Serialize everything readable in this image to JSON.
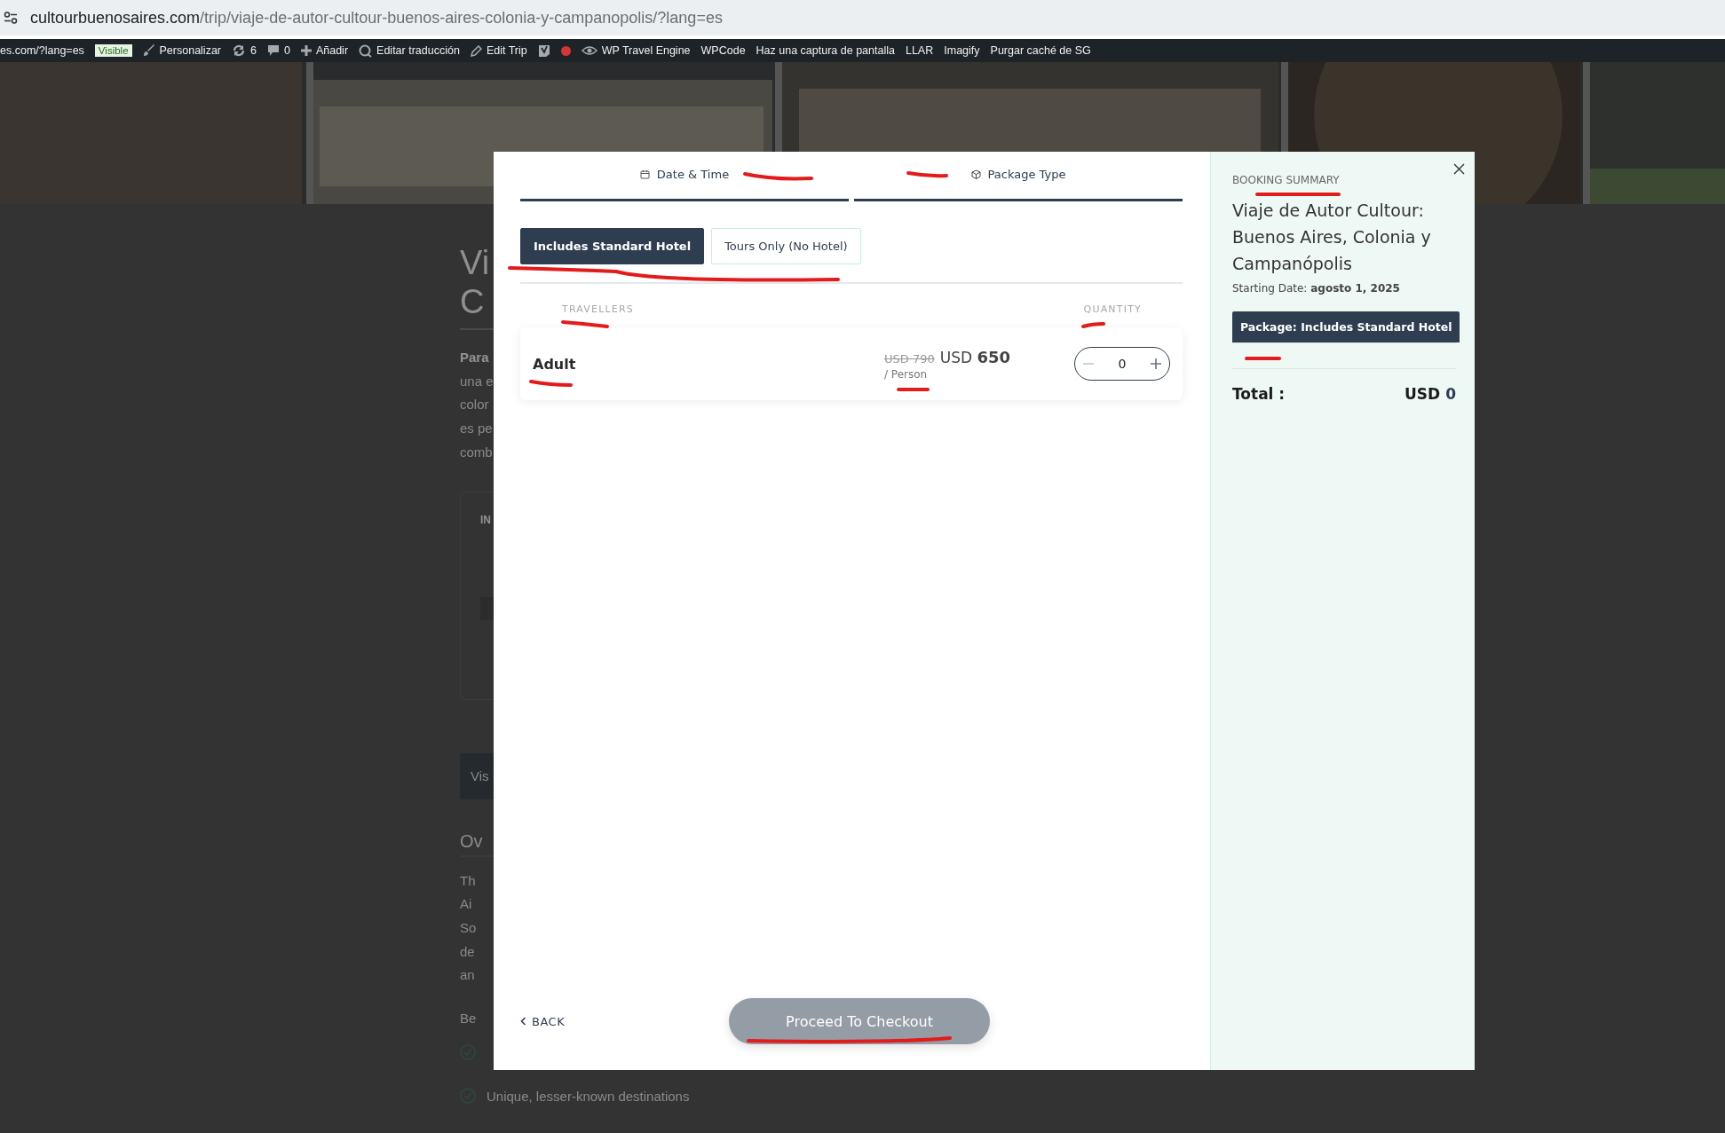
{
  "browser": {
    "url_host": "cultourbuenosaires.com",
    "url_path": "/trip/viaje-de-autor-cultour-buenos-aires-colonia-y-campanopolis/?lang=es"
  },
  "admin_bar": [
    {
      "kind": "text",
      "label": "es.com/?lang=es"
    },
    {
      "kind": "badge",
      "label": "Visible"
    },
    {
      "kind": "brush",
      "label": "Personalizar"
    },
    {
      "kind": "refresh",
      "label": "6"
    },
    {
      "kind": "comment",
      "label": "0"
    },
    {
      "kind": "plus",
      "label": "Añadir"
    },
    {
      "kind": "translate",
      "label": "Editar traducción"
    },
    {
      "kind": "pencil",
      "label": "Edit Trip"
    },
    {
      "kind": "seo"
    },
    {
      "kind": "dot"
    },
    {
      "kind": "engine",
      "label": "WP Travel Engine"
    },
    {
      "kind": "text",
      "label": "WPCode"
    },
    {
      "kind": "text",
      "label": "Haz una captura de pantalla"
    },
    {
      "kind": "text",
      "label": "LLAR"
    },
    {
      "kind": "text",
      "label": "Imagify"
    },
    {
      "kind": "text",
      "label": "Purgar caché de SG"
    }
  ],
  "background_page": {
    "title_lines": [
      "Vi",
      "C"
    ],
    "intro_lines": [
      "**Para**",
      "una e",
      "color",
      "es pe",
      "comb"
    ],
    "info_box_label": "IN",
    "tab_button": "Vis",
    "section_heading": "Ov",
    "overview_lines": [
      "Th",
      "Ai",
      "So",
      "de",
      "an"
    ],
    "highlights_label": "Be",
    "highlights": [
      {
        "kind": "icon_only"
      },
      {
        "kind": "text",
        "text": "Unique, lesser-known destinations"
      }
    ]
  },
  "booking_modal": {
    "steps": [
      {
        "kind": "calendar",
        "label": "Date & Time"
      },
      {
        "kind": "package",
        "label": "Package Type"
      }
    ],
    "packages": [
      {
        "label": "Includes Standard Hotel",
        "selected": true
      },
      {
        "label": "Tours Only (No Hotel)",
        "selected": false
      }
    ],
    "travellers_heading": "TRAVELLERS",
    "quantity_heading": "QUANTITY",
    "travellers": [
      {
        "name": "Adult",
        "old_price": "USD 790",
        "currency": "USD",
        "price": "650",
        "unit": "/ Person",
        "quantity": "0",
        "minus_disabled": true
      }
    ],
    "back": "BACK",
    "checkout": {
      "label": "Proceed To Checkout",
      "disabled": true
    },
    "summary": {
      "heading": "BOOKING SUMMARY",
      "trip_title": "Viaje de Autor Cultour: Buenos Aires, Colonia y Campanópolis",
      "starting_date": "Starting Date: **agosto 1, 2025**",
      "package_tag": "Package: Includes Standard Hotel",
      "total_label": "Total :",
      "total_currency": "USD",
      "total_value": "0"
    }
  }
}
